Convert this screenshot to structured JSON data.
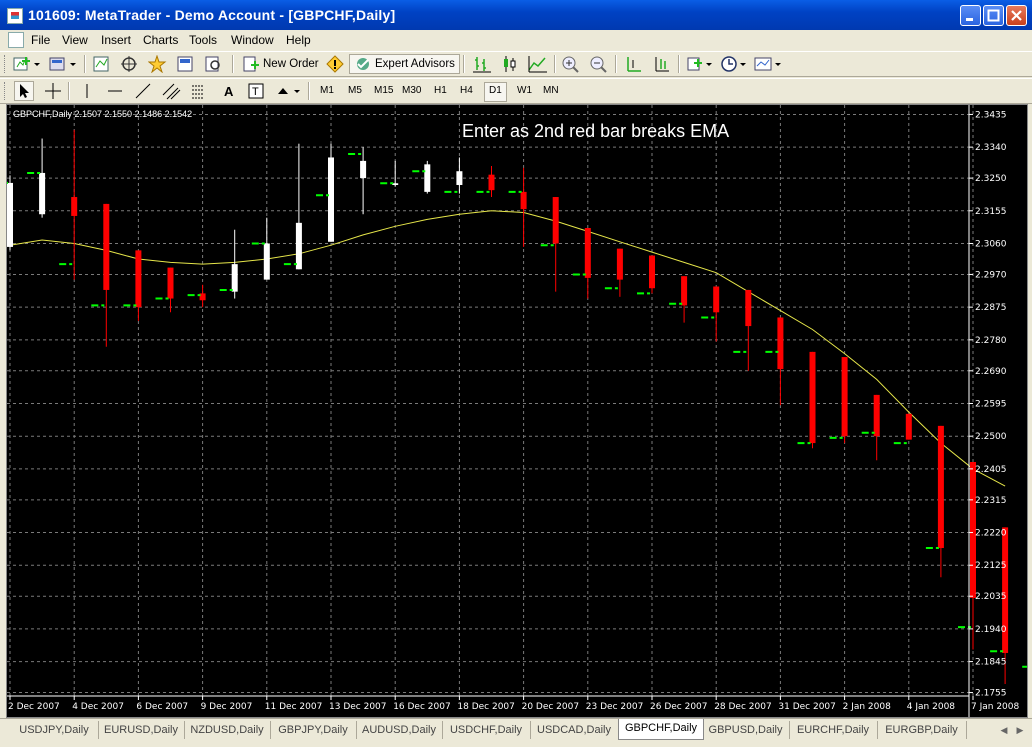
{
  "window": {
    "title": "101609: MetaTrader - Demo Account - [GBPCHF,Daily]"
  },
  "menu": [
    "File",
    "View",
    "Insert",
    "Charts",
    "Tools",
    "Window",
    "Help"
  ],
  "toolbar": {
    "new_order_label": "New Order",
    "expert_advisors_label": "Expert Advisors"
  },
  "timeframes": [
    "M1",
    "M5",
    "M15",
    "M30",
    "H1",
    "H4",
    "D1",
    "W1",
    "MN"
  ],
  "active_timeframe": "D1",
  "chart": {
    "symbol_info": "GBPCHF,Daily  2.1507 2.1550 2.1486 2.1542",
    "annotation": "Enter as 2nd red bar breaks EMA"
  },
  "tabs": [
    "USDJPY,Daily",
    "EURUSD,Daily",
    "NZDUSD,Daily",
    "GBPJPY,Daily",
    "AUDUSD,Daily",
    "USDCHF,Daily",
    "USDCAD,Daily",
    "GBPCHF,Daily",
    "GBPUSD,Daily",
    "EURCHF,Daily",
    "EURGBP,Daily"
  ],
  "active_tab": "GBPCHF,Daily",
  "colors": {
    "chart_background": "#000000",
    "bull_candle": "#ffffff",
    "bear_candle": "#ff0000",
    "marker": "#00ff00",
    "ema": "#e6e64a",
    "grid": "#7a7a7a"
  },
  "chart_data": {
    "type": "candlestick",
    "symbol": "GBPCHF",
    "timeframe": "Daily",
    "price_ticks": [
      "2.3435",
      "2.3340",
      "2.3250",
      "2.3155",
      "2.3060",
      "2.2970",
      "2.2875",
      "2.2780",
      "2.2690",
      "2.2595",
      "2.2500",
      "2.2405",
      "2.2315",
      "2.2220",
      "2.2125",
      "2.2035",
      "2.1940",
      "2.1845",
      "2.1755"
    ],
    "date_ticks": [
      "2 Dec 2007",
      "4 Dec 2007",
      "6 Dec 2007",
      "9 Dec 2007",
      "11 Dec 2007",
      "13 Dec 2007",
      "16 Dec 2007",
      "18 Dec 2007",
      "20 Dec 2007",
      "23 Dec 2007",
      "26 Dec 2007",
      "28 Dec 2007",
      "31 Dec 2007",
      "2 Jan 2008",
      "4 Jan 2008",
      "7 Jan 2008"
    ],
    "ylim": [
      2.1745,
      2.3445
    ],
    "candles": [
      {
        "o": 2.305,
        "h": 2.3258,
        "l": 2.304,
        "c": 2.3236,
        "m": 2.3236
      },
      {
        "o": 2.3145,
        "h": 2.3365,
        "l": 2.3135,
        "c": 2.3265,
        "m": 2.3265
      },
      {
        "o": 2.3195,
        "h": 2.339,
        "l": 2.2955,
        "c": 2.314,
        "m": 2.3
      },
      {
        "o": 2.3175,
        "h": 2.3175,
        "l": 2.276,
        "c": 2.2925,
        "m": 2.288
      },
      {
        "o": 2.304,
        "h": 2.304,
        "l": 2.2835,
        "c": 2.2875,
        "m": 2.288
      },
      {
        "o": 2.299,
        "h": 2.299,
        "l": 2.286,
        "c": 2.29,
        "m": 2.29
      },
      {
        "o": 2.2915,
        "h": 2.294,
        "l": 2.2875,
        "c": 2.2895,
        "m": 2.291
      },
      {
        "o": 2.292,
        "h": 2.31,
        "l": 2.29,
        "c": 2.3,
        "m": 2.2925
      },
      {
        "o": 2.2955,
        "h": 2.3135,
        "l": 2.2955,
        "c": 2.306,
        "m": 2.306
      },
      {
        "o": 2.2985,
        "h": 2.335,
        "l": 2.2985,
        "c": 2.312,
        "m": 2.3
      },
      {
        "o": 2.3065,
        "h": 2.335,
        "l": 2.3065,
        "c": 2.331,
        "m": 2.32
      },
      {
        "o": 2.325,
        "h": 2.334,
        "l": 2.3145,
        "c": 2.33,
        "m": 2.332
      },
      {
        "o": 2.323,
        "h": 2.33,
        "l": 2.3225,
        "c": 2.3235,
        "m": 2.3235
      },
      {
        "o": 2.321,
        "h": 2.33,
        "l": 2.3205,
        "c": 2.329,
        "m": 2.327
      },
      {
        "o": 2.323,
        "h": 2.331,
        "l": 2.3205,
        "c": 2.327,
        "m": 2.321
      },
      {
        "o": 2.326,
        "h": 2.3285,
        "l": 2.3195,
        "c": 2.3215,
        "m": 2.321
      },
      {
        "o": 2.321,
        "h": 2.328,
        "l": 2.305,
        "c": 2.316,
        "m": 2.321
      },
      {
        "o": 2.3195,
        "h": 2.3195,
        "l": 2.292,
        "c": 2.306,
        "m": 2.3055
      },
      {
        "o": 2.3105,
        "h": 2.3105,
        "l": 2.29,
        "c": 2.296,
        "m": 2.297
      },
      {
        "o": 2.3045,
        "h": 2.3045,
        "l": 2.2905,
        "c": 2.2955,
        "m": 2.293
      },
      {
        "o": 2.3025,
        "h": 2.3025,
        "l": 2.2915,
        "c": 2.293,
        "m": 2.2915
      },
      {
        "o": 2.2965,
        "h": 2.2965,
        "l": 2.283,
        "c": 2.288,
        "m": 2.2885
      },
      {
        "o": 2.2935,
        "h": 2.2935,
        "l": 2.2775,
        "c": 2.286,
        "m": 2.2845
      },
      {
        "o": 2.2925,
        "h": 2.2925,
        "l": 2.269,
        "c": 2.282,
        "m": 2.2745
      },
      {
        "o": 2.2845,
        "h": 2.2845,
        "l": 2.259,
        "c": 2.2695,
        "m": 2.2745
      },
      {
        "o": 2.2745,
        "h": 2.2745,
        "l": 2.2465,
        "c": 2.248,
        "m": 2.248
      },
      {
        "o": 2.273,
        "h": 2.273,
        "l": 2.248,
        "c": 2.25,
        "m": 2.2495
      },
      {
        "o": 2.262,
        "h": 2.262,
        "l": 2.243,
        "c": 2.25,
        "m": 2.251
      },
      {
        "o": 2.2565,
        "h": 2.2565,
        "l": 2.249,
        "c": 2.249,
        "m": 2.248
      },
      {
        "o": 2.253,
        "h": 2.253,
        "l": 2.209,
        "c": 2.2175,
        "m": 2.2175
      },
      {
        "o": 2.2425,
        "h": 2.2425,
        "l": 2.188,
        "c": 2.203,
        "m": 2.1945
      },
      {
        "o": 2.2235,
        "h": 2.2235,
        "l": 2.178,
        "c": 2.187,
        "m": 2.1875
      },
      {
        "o": 2.2095,
        "h": 2.2095,
        "l": 2.182,
        "c": 2.185,
        "m": 2.183
      },
      {
        "o": 2.2055,
        "h": 2.2055,
        "l": 2.1855,
        "c": 2.193,
        "m": 2.199
      }
    ],
    "ema": [
      2.3055,
      2.307,
      2.306,
      2.304,
      2.3015,
      2.3005,
      2.3,
      2.3005,
      2.3015,
      2.303,
      2.3055,
      2.3085,
      2.311,
      2.313,
      2.3145,
      2.3155,
      2.315,
      2.3125,
      2.3095,
      2.3065,
      2.3035,
      2.3005,
      2.2975,
      2.292,
      2.2865,
      2.281,
      2.274,
      2.2665,
      2.257,
      2.248,
      2.2405,
      2.2355
    ]
  }
}
